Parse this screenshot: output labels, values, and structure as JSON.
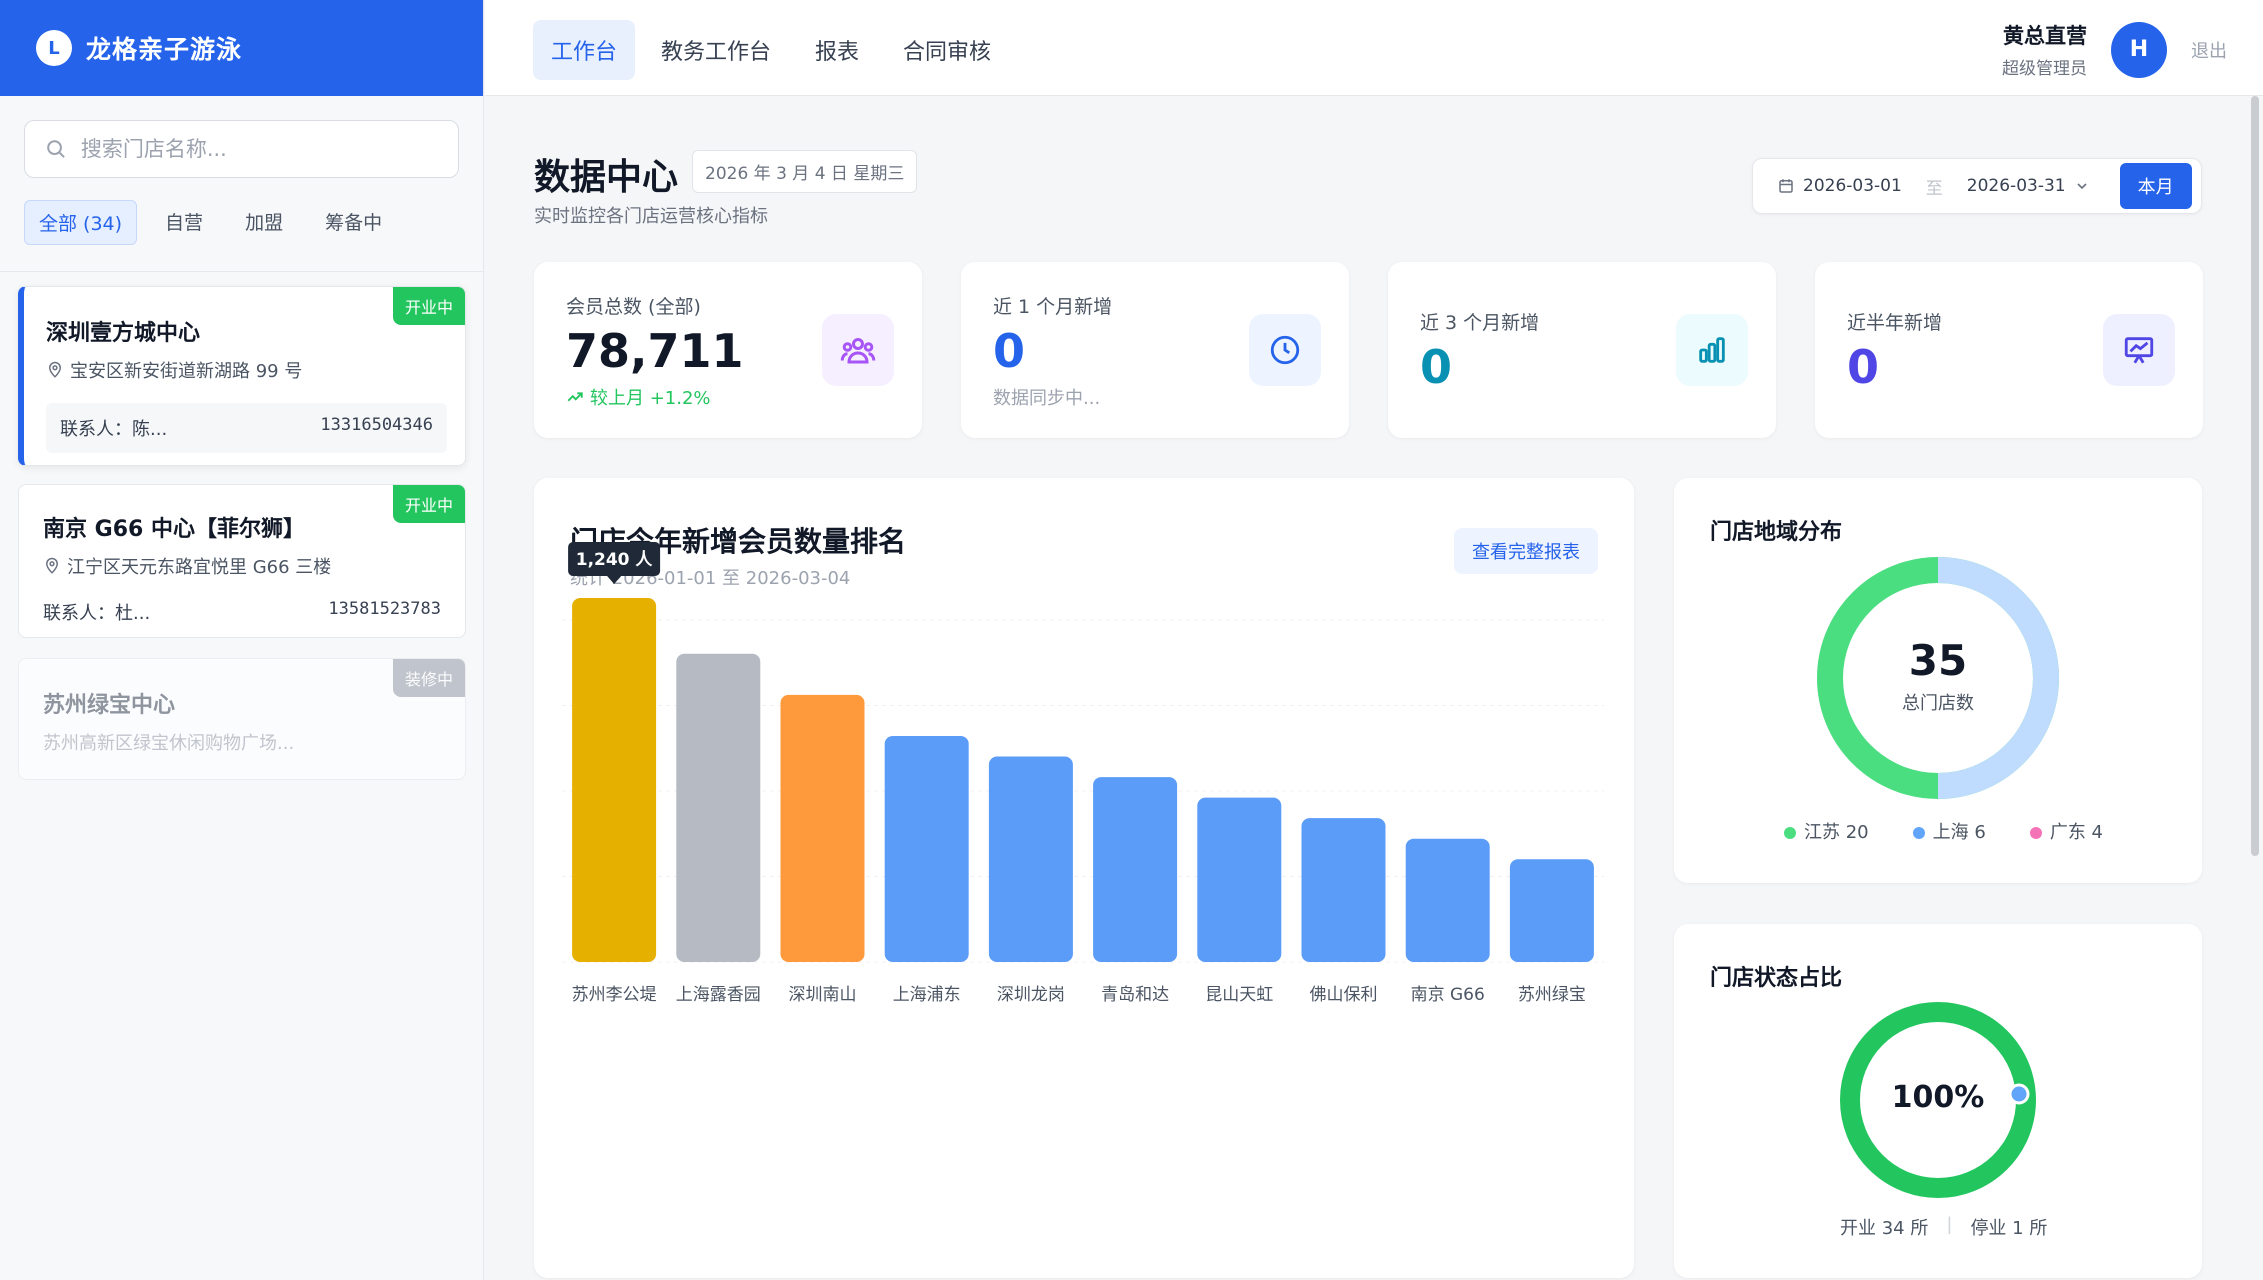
{
  "brand": {
    "logo_letter": "L",
    "name": "龙格亲子游泳"
  },
  "search": {
    "placeholder": "搜索门店名称..."
  },
  "filters": [
    {
      "label": "全部 (34)",
      "active": true
    },
    {
      "label": "自营"
    },
    {
      "label": "加盟"
    },
    {
      "label": "筹备中"
    }
  ],
  "stores": [
    {
      "name": "深圳壹方城中心",
      "address": "宝安区新安街道新湖路 99 号",
      "contact": "联系人：陈...",
      "phone": "13316504346",
      "status": "开业中"
    },
    {
      "name": "南京 G66 中心【菲尔狮】",
      "address": "江宁区天元东路宜悦里 G66 三楼",
      "contact": "联系人：杜...",
      "phone": "13581523783",
      "status": "开业中"
    },
    {
      "name": "苏州绿宝中心",
      "address": "苏州高新区绿宝休闲购物广场...",
      "status": "装修中"
    }
  ],
  "nav": {
    "tabs": [
      "工作台",
      "教务工作台",
      "报表",
      "合同审核"
    ],
    "user_name": "黄总直营",
    "user_role": "超级管理员",
    "avatar": "H",
    "logout": "退出"
  },
  "header": {
    "title": "数据中心",
    "date": "2026 年 3 月 4 日 星期三",
    "subtitle": "实时监控各门店运营核心指标",
    "range_start": "2026-03-01",
    "range_sep": "至",
    "range_end": "2026-03-31",
    "month_btn": "本月"
  },
  "kpis": [
    {
      "label": "会员总数 (全部)",
      "value": "78,711",
      "foot": "较上月 +1.2%",
      "color": "#111827",
      "icon": "users-icon"
    },
    {
      "label": "近 1 个月新增",
      "value": "0",
      "foot": "数据同步中...",
      "color": "#2563eb",
      "icon": "clock-icon"
    },
    {
      "label": "近 3 个月新增",
      "value": "0",
      "color": "#0891b2",
      "icon": "bar-chart-icon"
    },
    {
      "label": "近半年新增",
      "value": "0",
      "color": "#4f46e5",
      "icon": "presentation-chart-icon"
    }
  ],
  "ranking": {
    "title": "门店今年新增会员数量排名",
    "sub": "统计 2026-01-01 至 2026-03-04",
    "report_btn": "查看完整报表",
    "tooltip": "1,240 人"
  },
  "chart_data": {
    "type": "bar",
    "title": "门店今年新增会员数量排名",
    "categories": [
      "苏州李公堤",
      "上海露香园",
      "深圳南山",
      "上海浦东",
      "深圳龙岗",
      "青岛和达",
      "昆山天虹",
      "佛山保利",
      "南京 G66",
      "苏州绿宝"
    ],
    "values": [
      1240,
      1050,
      910,
      770,
      700,
      630,
      560,
      490,
      420,
      350
    ],
    "colors": [
      "#e6b000",
      "#b6bac3",
      "#ff9a3c",
      "#5a9cf8",
      "#5a9cf8",
      "#5a9cf8",
      "#5a9cf8",
      "#5a9cf8",
      "#5a9cf8",
      "#5a9cf8"
    ],
    "ylim": [
      0,
      1400
    ],
    "grid": true
  },
  "region": {
    "title": "门店地域分布",
    "total": "35",
    "total_label": "总门店数",
    "items": [
      {
        "label": "江苏 20",
        "value": 20,
        "color": "#4ade80"
      },
      {
        "label": "上海 6",
        "value": 6,
        "color": "#60a5fa"
      },
      {
        "label": "广东 4",
        "value": 4,
        "color": "#f472b6"
      }
    ]
  },
  "status": {
    "title": "门店状态占比",
    "percent": "100%",
    "open": "开业 34 所",
    "sep": "|",
    "closed": "停业 1 所"
  }
}
